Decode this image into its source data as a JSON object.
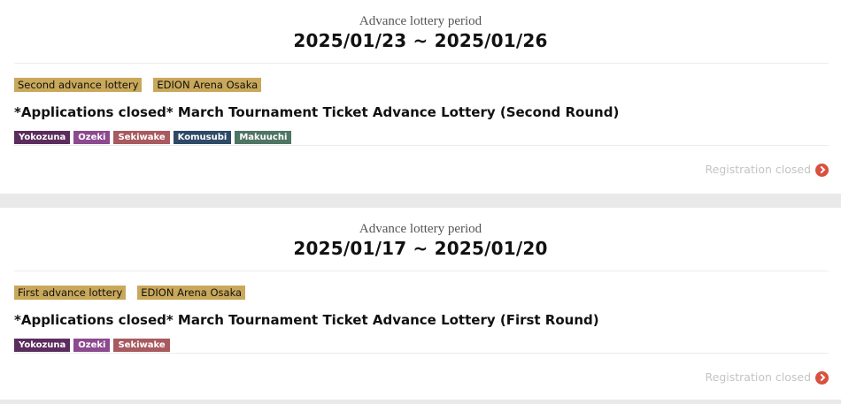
{
  "colors": {
    "tag_bg": "#c9a85a",
    "status_text": "#c4c4c4",
    "status_icon": "#d9503f"
  },
  "lotteries": [
    {
      "period_label": "Advance lottery period",
      "period_dates": "2025/01/23 ~ 2025/01/26",
      "tags": [
        "Second advance lottery",
        "EDION Arena Osaka"
      ],
      "title": "*Applications closed* March Tournament Ticket Advance Lottery (Second Round)",
      "ranks": [
        {
          "label": "Yokozuna",
          "color": "#5b2d5e"
        },
        {
          "label": "Ozeki",
          "color": "#8c4a8f"
        },
        {
          "label": "Sekiwake",
          "color": "#a85a5f"
        },
        {
          "label": "Komusubi",
          "color": "#2e4a66"
        },
        {
          "label": "Makuuchi",
          "color": "#4f7564"
        }
      ],
      "status": "Registration closed",
      "status_icon": "chevron-right-icon"
    },
    {
      "period_label": "Advance lottery period",
      "period_dates": "2025/01/17 ~ 2025/01/20",
      "tags": [
        "First advance lottery",
        "EDION Arena Osaka"
      ],
      "title": "*Applications closed* March Tournament Ticket Advance Lottery (First Round)",
      "ranks": [
        {
          "label": "Yokozuna",
          "color": "#5b2d5e"
        },
        {
          "label": "Ozeki",
          "color": "#8c4a8f"
        },
        {
          "label": "Sekiwake",
          "color": "#a85a5f"
        }
      ],
      "status": "Registration closed",
      "status_icon": "chevron-right-icon"
    }
  ]
}
